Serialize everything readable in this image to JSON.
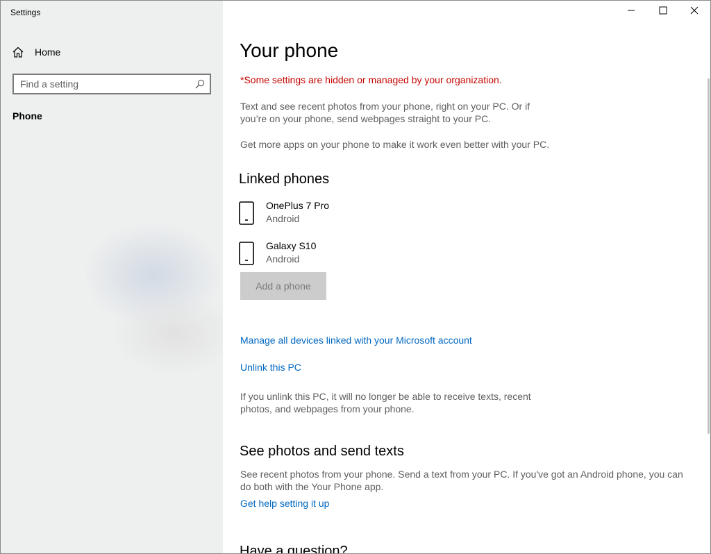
{
  "window": {
    "title": "Settings",
    "controls": {
      "minimize": "minimize-icon",
      "maximize": "maximize-icon",
      "close": "close-icon"
    }
  },
  "sidebar": {
    "home_label": "Home",
    "home_icon": "home-icon",
    "search": {
      "placeholder": "Find a setting",
      "value": "",
      "icon": "search-icon"
    },
    "items": [
      {
        "label": "Phone",
        "selected": true
      }
    ]
  },
  "main": {
    "title": "Your phone",
    "managed_notice": "*Some settings are hidden or managed by your organization.",
    "description": "Text and see recent photos from your phone, right on your PC. Or if you’re on your phone, send webpages straight to your PC.",
    "more_apps": "Get more apps on your phone to make it work even better with your PC.",
    "linked_phones": {
      "heading": "Linked phones",
      "devices": [
        {
          "name": "OnePlus 7 Pro",
          "os": "Android",
          "icon": "phone-icon"
        },
        {
          "name": "Galaxy S10",
          "os": "Android",
          "icon": "phone-icon"
        }
      ],
      "add_button": "Add a phone",
      "manage_link": "Manage all devices linked with your Microsoft account",
      "unlink_link": "Unlink this PC",
      "unlink_description": "If you unlink this PC, it will no longer be able to receive texts, recent photos, and webpages from your phone."
    },
    "photos_texts": {
      "heading": "See photos and send texts",
      "description": "See recent photos from your phone. Send a text from your PC. If you've got an Android phone, you can do both with the Your Phone app.",
      "help_link": "Get help setting it up"
    },
    "question_heading": "Have a question?"
  },
  "colors": {
    "accent_link": "#0067c0",
    "warning": "#c50500",
    "secondary_text": "#5d5d5d",
    "sidebar_bg": "#eeefef",
    "disabled_button_bg": "#cccccc"
  }
}
